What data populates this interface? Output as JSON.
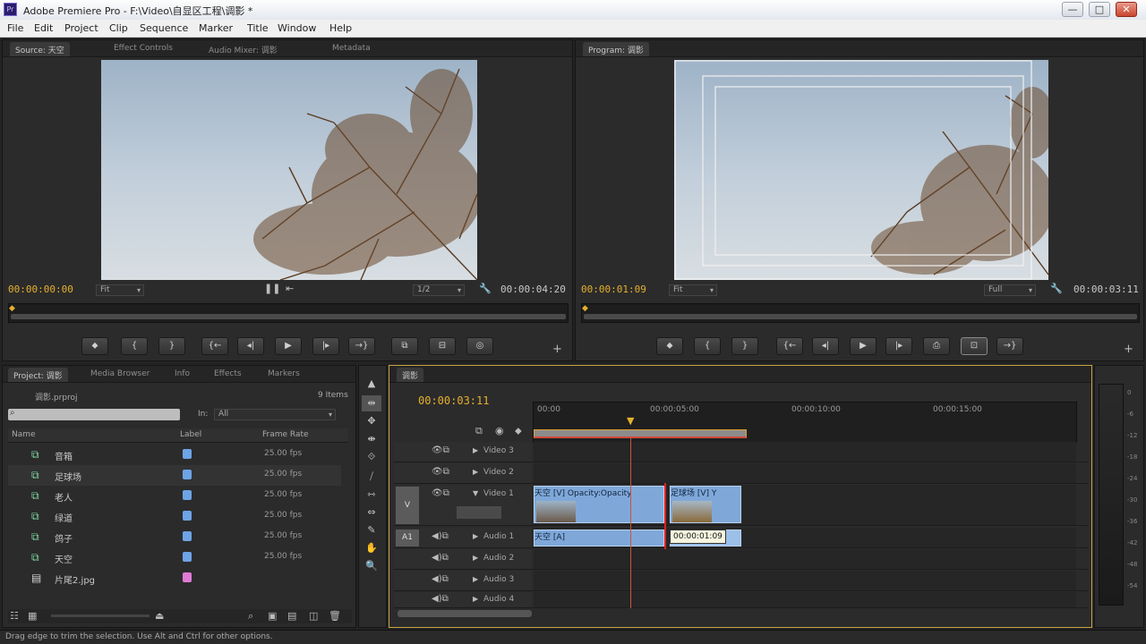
{
  "window": {
    "title": "Adobe Premiere Pro - F:\\Video\\自显区工程\\调影 *",
    "minimize": "—",
    "maximize": "□",
    "close": "✕"
  },
  "menu": [
    "File",
    "Edit",
    "Project",
    "Clip",
    "Sequence",
    "Marker",
    "Title",
    "Window",
    "Help"
  ],
  "source_monitor": {
    "tabs": [
      "Source: 天空",
      "Effect Controls",
      "Audio Mixer: 调影",
      "Metadata"
    ],
    "timecode_in": "00:00:00:00",
    "zoom": "Fit",
    "resolution": "1/2",
    "duration": "00:00:04:20",
    "buttons": [
      "⬥",
      "{",
      "}",
      "{←",
      "◂|",
      "▶",
      "|▸",
      "→}",
      "⧉",
      "⊟",
      "◎"
    ]
  },
  "program_monitor": {
    "tabs": [
      "Program: 调影"
    ],
    "timecode": "00:00:01:09",
    "zoom": "Fit",
    "resolution": "Full",
    "duration": "00:00:03:11",
    "buttons": [
      "⬥",
      "{",
      "}",
      "{←",
      "◂|",
      "▶",
      "|▸",
      "⎙",
      "⊡",
      "→}"
    ]
  },
  "project": {
    "tabs": [
      "Project: 调影",
      "Media Browser",
      "Info",
      "Effects",
      "Markers"
    ],
    "file": "调影.prproj",
    "count": "9 Items",
    "in_label": "In:",
    "in_value": "All",
    "columns": [
      "Name",
      "Label",
      "Frame Rate"
    ],
    "items": [
      {
        "name": "音箱",
        "rate": "25.00 fps",
        "color": "#6ea3e6"
      },
      {
        "name": "足球场",
        "rate": "25.00 fps",
        "color": "#6ea3e6"
      },
      {
        "name": "老人",
        "rate": "25.00 fps",
        "color": "#6ea3e6"
      },
      {
        "name": "绿道",
        "rate": "25.00 fps",
        "color": "#6ea3e6"
      },
      {
        "name": "鸽子",
        "rate": "25.00 fps",
        "color": "#6ea3e6"
      },
      {
        "name": "天空",
        "rate": "25.00 fps",
        "color": "#6ea3e6"
      },
      {
        "name": "片尾2.jpg",
        "rate": "",
        "color": "#e07ad6"
      }
    ]
  },
  "timeline": {
    "tab": "调影",
    "timecode": "00:00:03:11",
    "ruler": [
      "00:00",
      "00:00:05:00",
      "00:00:10:00",
      "00:00:15:00"
    ],
    "tracks": [
      {
        "name": "Video 3",
        "target": ""
      },
      {
        "name": "Video 2",
        "target": ""
      },
      {
        "name": "Video 1",
        "target": "V"
      },
      {
        "name": "Audio 1",
        "target": "A1"
      },
      {
        "name": "Audio 2",
        "target": ""
      },
      {
        "name": "Audio 3",
        "target": ""
      },
      {
        "name": "Audio 4",
        "target": ""
      }
    ],
    "clips": {
      "v1_a": "天空 [V] Opacity:Opacity",
      "v1_b": "足球场 [V] Y",
      "a1_a": "天空 [A]",
      "tooltip": "00:00:01:09"
    }
  },
  "status": "Drag edge to trim the selection. Use Alt and Ctrl for other options.",
  "tools": [
    "▲",
    "⇹",
    "✥",
    "⇼",
    "⟐",
    "⧸",
    "⇿",
    "⇔",
    "✎",
    "✋",
    "🔍"
  ]
}
